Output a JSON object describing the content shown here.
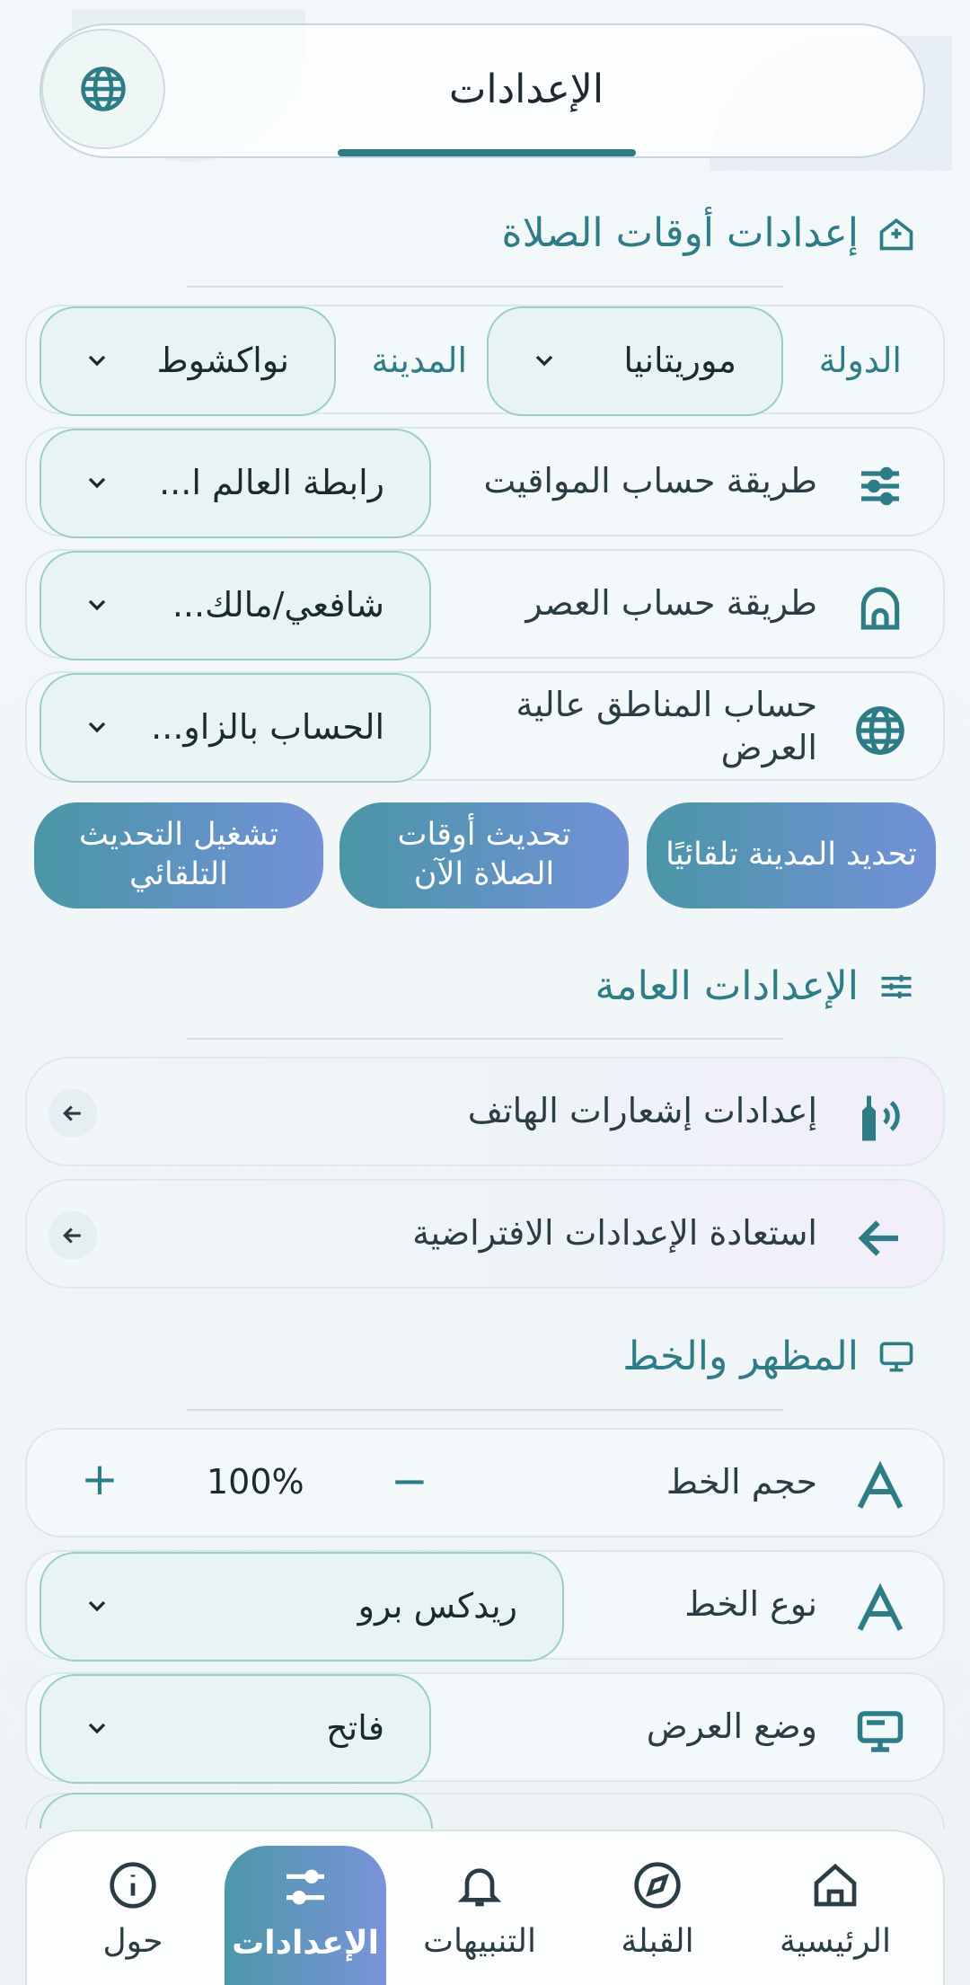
{
  "header": {
    "title": "الإعدادات"
  },
  "prayer_section": {
    "title": "إعدادات أوقات الصلاة",
    "country_label": "الدولة",
    "country_value": "موريتانيا",
    "city_label": "المدينة",
    "city_value": "نواكشوط",
    "method_label": "طريقة حساب المواقيت",
    "method_value": "رابطة العالم ا...",
    "asr_label": "طريقة حساب العصر",
    "asr_value": "شافعي/مالك...",
    "highlat_label": "حساب المناطق عالية العرض",
    "highlat_value": "الحساب بالزاو...",
    "buttons": {
      "detect_city": "تحديد المدينة تلقائيًا",
      "update_now": "تحديث أوقات الصلاة الآن",
      "auto_update": "تشغيل التحديث التلقائي"
    }
  },
  "general_section": {
    "title": "الإعدادات العامة",
    "notifications": "إعدادات إشعارات الهاتف",
    "restore_defaults": "استعادة الإعدادات الافتراضية"
  },
  "appearance_section": {
    "title": "المظهر والخط",
    "font_size_label": "حجم الخط",
    "font_size_value": "100%",
    "minus": "−",
    "plus": "+",
    "font_type_label": "نوع الخط",
    "font_type_value": "ريدكس برو",
    "display_mode_label": "وضع العرض",
    "display_mode_value": "فاتح"
  },
  "bottom_nav": {
    "home": "الرئيسية",
    "qibla": "القبلة",
    "alerts": "التنبيهات",
    "settings": "الإعدادات",
    "about": "حول"
  },
  "colors": {
    "accent": "#2e7d86",
    "gradient_start": "#4a96a6",
    "gradient_end": "#7291d8"
  }
}
